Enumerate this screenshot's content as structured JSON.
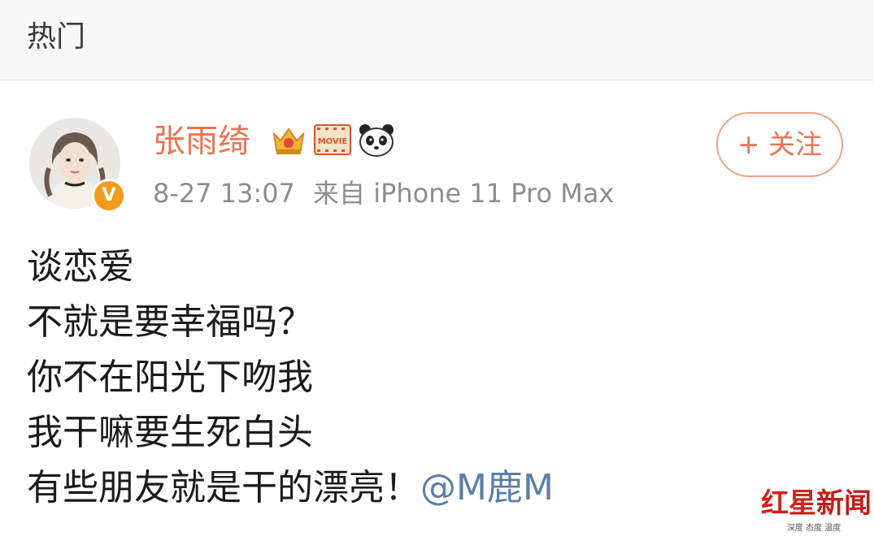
{
  "header": {
    "title": "热门"
  },
  "post": {
    "user": {
      "name": "张雨绮",
      "verified_badge": "V",
      "badges": [
        "crown-icon",
        "movie-icon",
        "panda-icon"
      ],
      "movie_badge_text": "MOVIE"
    },
    "meta": {
      "time": "8-27 13:07",
      "source": "来自 iPhone 11 Pro Max"
    },
    "follow_label": "+ 关注",
    "lines": [
      "谈恋爱",
      "不就是要幸福吗？",
      "你不在阳光下吻我",
      "我干嘛要生死白头"
    ],
    "last_line_text": "有些朋友就是干的漂亮！",
    "mention": "@M鹿M"
  },
  "watermark": {
    "logo_part1": "红星",
    "logo_part2": "新闻",
    "tagline": "深度 态度 温度"
  },
  "colors": {
    "username": "#eb7350",
    "mention": "#5a7fa7",
    "meta": "#8d8d8d",
    "verified": "#f29b1c",
    "watermark": "#d4201c"
  }
}
